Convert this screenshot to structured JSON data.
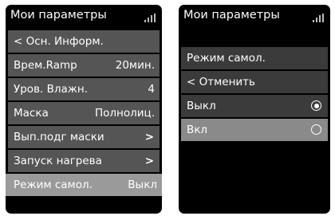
{
  "left_screen": {
    "title": "Мои параметры",
    "items": [
      {
        "label": "< Осн. Информ.",
        "value": ""
      },
      {
        "label": "Врем.Ramp",
        "value": "20мин."
      },
      {
        "label": "Уров. Влажн.",
        "value": "4"
      },
      {
        "label": "Маска",
        "value": "Полнолиц."
      },
      {
        "label": "Вып.подг маски",
        "value": ">"
      },
      {
        "label": "Запуск нагрева",
        "value": ">"
      },
      {
        "label": "Режим самол.",
        "value": "Выкл"
      }
    ]
  },
  "right_screen": {
    "title": "Мои параметры",
    "header": "Режим самол.",
    "back": "< Отменить",
    "options": [
      {
        "label": "Выкл",
        "selected": true
      },
      {
        "label": "Вкл",
        "selected": false
      }
    ]
  },
  "colors": {
    "screen_bg": "#000000",
    "item_bg": "#555555",
    "item_selected": "#8a8a8a",
    "text": "#ffffff"
  }
}
